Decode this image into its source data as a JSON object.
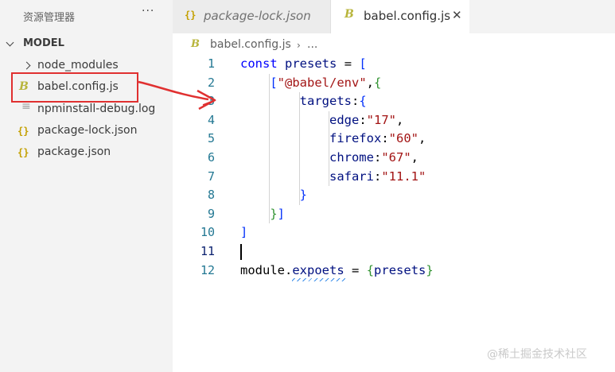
{
  "sidebar": {
    "title": "资源管理器",
    "more_label": "···",
    "section": "MODEL",
    "items": [
      {
        "label": "node_modules",
        "icon": "folder-chevron-icon"
      },
      {
        "label": "babel.config.js",
        "icon": "babel-icon"
      },
      {
        "label": "npminstall-debug.log",
        "icon": "log-icon"
      },
      {
        "label": "package-lock.json",
        "icon": "json-braces-icon"
      },
      {
        "label": "package.json",
        "icon": "json-braces-icon"
      }
    ]
  },
  "tabs": [
    {
      "label": "package-lock.json",
      "icon": "{}",
      "active": false
    },
    {
      "label": "babel.config.js",
      "icon": "B",
      "active": true,
      "close": "✕"
    }
  ],
  "breadcrumb": {
    "file": "babel.config.js",
    "separator": "›",
    "more": "..."
  },
  "editor": {
    "language": "javascript",
    "active_line": 11,
    "lines": [
      {
        "n": "1",
        "text": "const presets = ["
      },
      {
        "n": "2",
        "text": "    [\"@babel/env\",{"
      },
      {
        "n": "3",
        "text": "        targets:{"
      },
      {
        "n": "4",
        "text": "            edge:\"17\","
      },
      {
        "n": "5",
        "text": "            firefox:\"60\","
      },
      {
        "n": "6",
        "text": "            chrome:\"67\","
      },
      {
        "n": "7",
        "text": "            safari:\"11.1\""
      },
      {
        "n": "8",
        "text": "        }"
      },
      {
        "n": "9",
        "text": "    }]"
      },
      {
        "n": "10",
        "text": "]"
      },
      {
        "n": "11",
        "text": ""
      },
      {
        "n": "12",
        "text": "module.expoets = {presets}"
      }
    ]
  },
  "colors": {
    "keyword": "#0000ff",
    "variable": "#001080",
    "string": "#a31515",
    "highlight": "#e03030"
  },
  "watermark": "@稀土掘金技术社区",
  "babel_glyph": "B",
  "json_glyph": "{}"
}
